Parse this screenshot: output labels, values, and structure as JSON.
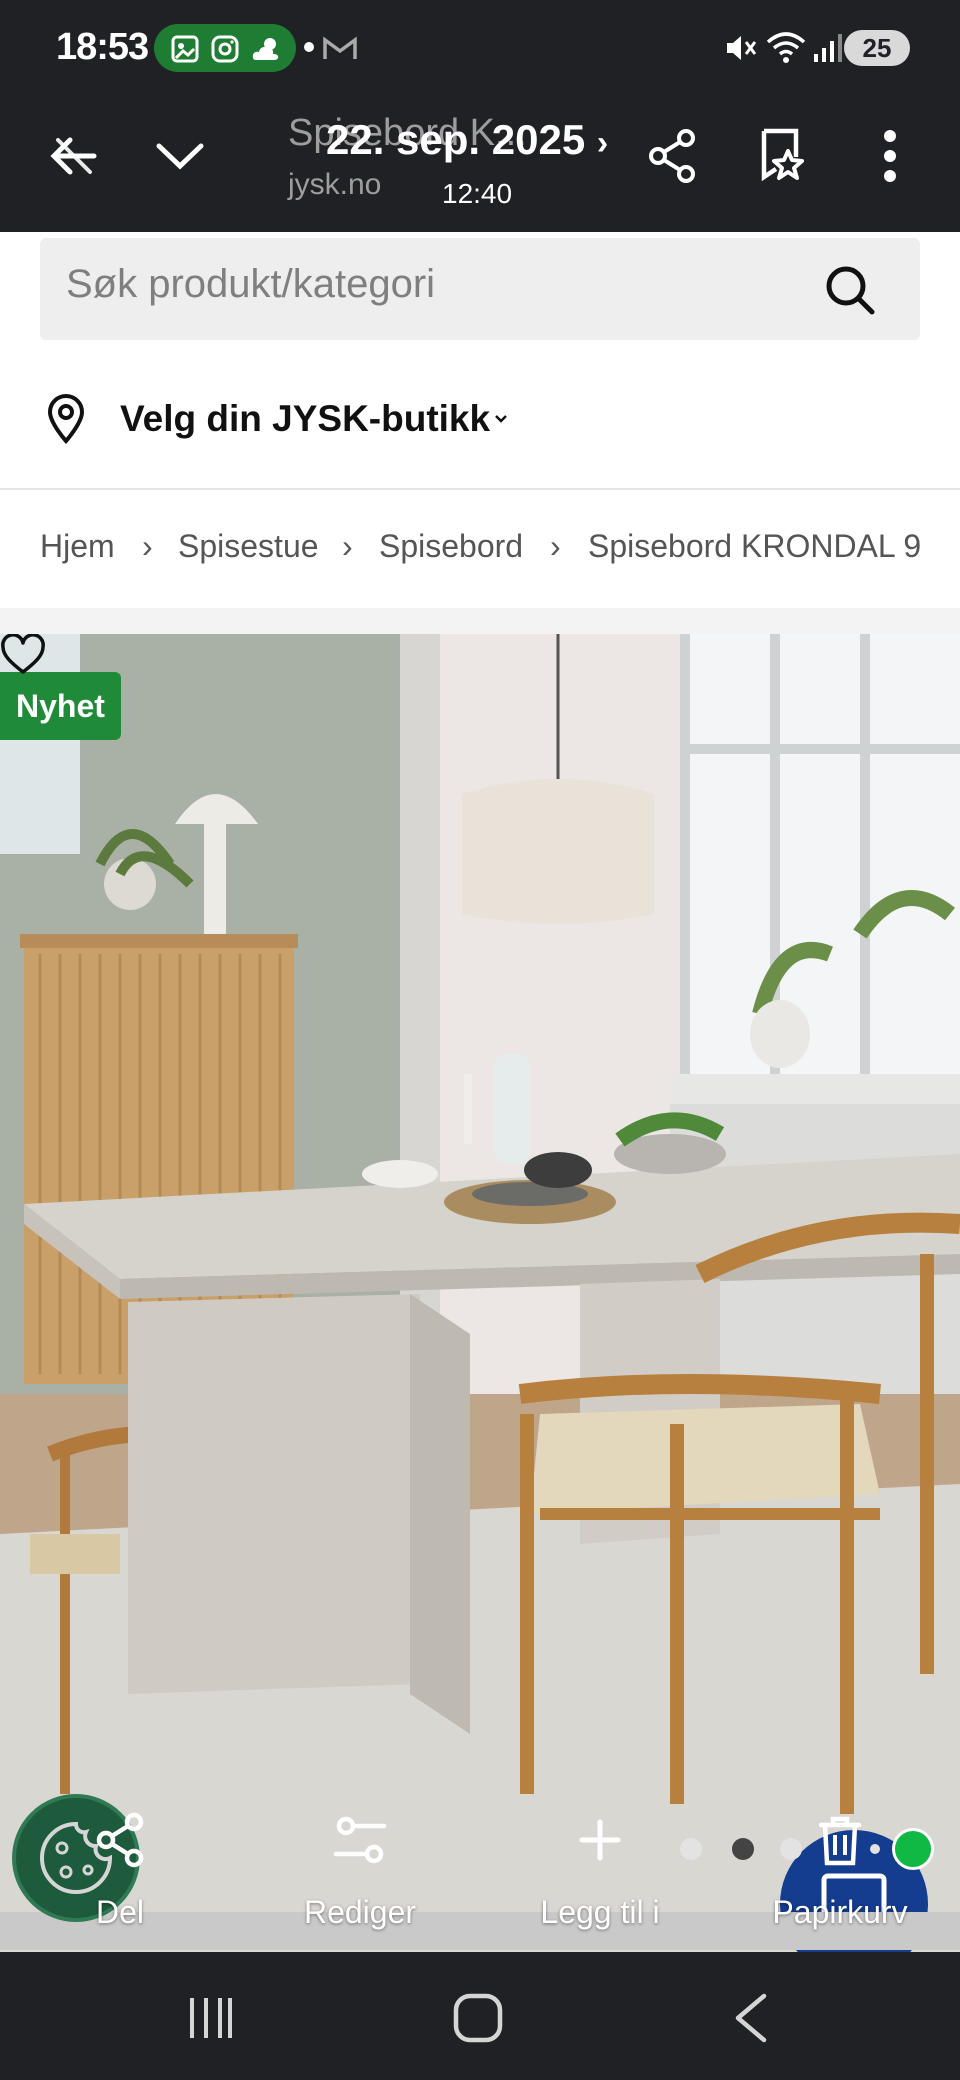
{
  "status_bar": {
    "time": "18:53",
    "battery": "25",
    "icons": [
      "gallery-icon",
      "instagram-icon",
      "weather-icon",
      "gmail-icon",
      "mute-icon",
      "wifi-icon",
      "signal-icon"
    ]
  },
  "toolbar": {
    "page_title": "Spisebord K...",
    "domain": "jysk.no",
    "date": "22. sep. 2025",
    "time": "12:40"
  },
  "search": {
    "placeholder": "Søk produkt/kategori"
  },
  "store": {
    "label": "Velg din JYSK-butikk"
  },
  "breadcrumbs": [
    "Hjem",
    "Spisestue",
    "Spisebord",
    "Spisebord KRONDAL 9"
  ],
  "product": {
    "badge": "Nyhet"
  },
  "actions": {
    "share": "Del",
    "edit": "Rediger",
    "add": "Legg til i",
    "trash": "Papirkurv"
  },
  "colors": {
    "badge_green": "#1f8a38",
    "chat_blue": "#143c8f",
    "online_green": "#10b844"
  }
}
